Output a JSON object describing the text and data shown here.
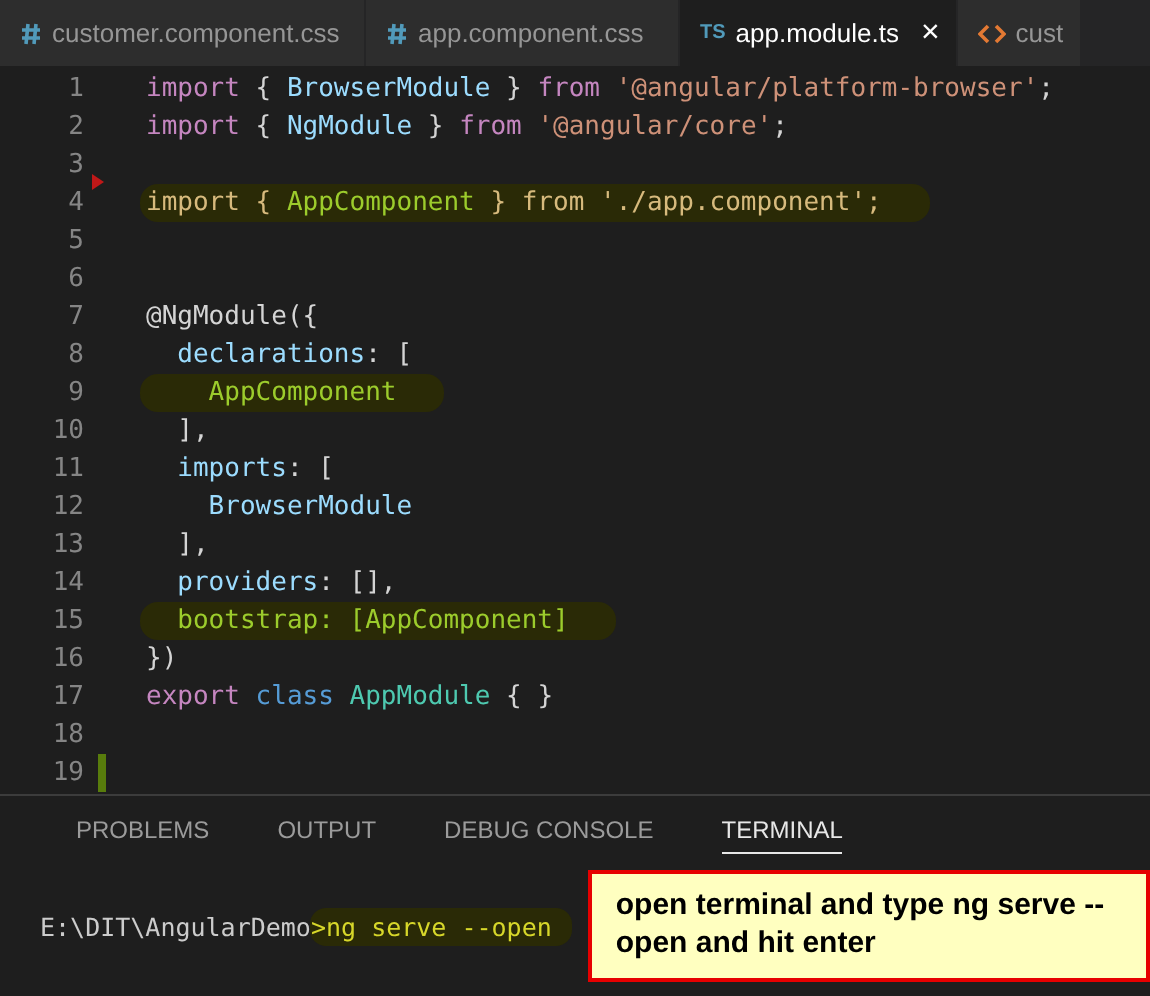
{
  "tabs": [
    {
      "label": "customer.component.css",
      "kind": "css",
      "selected": false
    },
    {
      "label": "app.component.css",
      "kind": "css",
      "selected": false
    },
    {
      "label": "app.module.ts",
      "kind": "ts",
      "icon_text": "TS",
      "close": "×",
      "selected": true
    },
    {
      "label": "cust",
      "kind": "html",
      "selected": false
    }
  ],
  "editor": {
    "lines": [
      {
        "number": "1",
        "highlighted": false,
        "added": false,
        "removed": false,
        "tokens": [
          {
            "text": "import",
            "kind": "keyword"
          },
          {
            "text": " { ",
            "kind": "punct"
          },
          {
            "text": "BrowserModule",
            "kind": "ident"
          },
          {
            "text": " } ",
            "kind": "punct"
          },
          {
            "text": "from",
            "kind": "keyword"
          },
          {
            "text": " '@angular/platform-browser'",
            "kind": "string"
          },
          {
            "text": ";",
            "kind": "punct"
          }
        ]
      },
      {
        "number": "2",
        "highlighted": false,
        "added": false,
        "removed": false,
        "tokens": [
          {
            "text": "import",
            "kind": "keyword"
          },
          {
            "text": " { ",
            "kind": "punct"
          },
          {
            "text": "NgModule",
            "kind": "ident"
          },
          {
            "text": " } ",
            "kind": "punct"
          },
          {
            "text": "from",
            "kind": "keyword"
          },
          {
            "text": " '@angular/core'",
            "kind": "string"
          },
          {
            "text": ";",
            "kind": "punct"
          }
        ]
      },
      {
        "number": "3",
        "highlighted": false,
        "added": false,
        "removed": false
      },
      {
        "number": "4",
        "highlighted": true,
        "added": false,
        "removed": true,
        "tokens": [
          {
            "text": "import { ",
            "kind": "hl"
          },
          {
            "text": "AppComponent",
            "kind": "hl_name"
          },
          {
            "text": " } from './app.component';",
            "kind": "hl"
          }
        ]
      },
      {
        "number": "5",
        "highlighted": false,
        "added": false,
        "removed": false
      },
      {
        "number": "6",
        "highlighted": false,
        "added": false,
        "removed": false
      },
      {
        "number": "7",
        "highlighted": false,
        "added": false,
        "removed": false,
        "tokens": [
          {
            "text": "@NgModule",
            "kind": "punct"
          },
          {
            "text": "({",
            "kind": "punct"
          }
        ]
      },
      {
        "number": "8",
        "highlighted": false,
        "added": false,
        "removed": false,
        "tokens": [
          {
            "text": "  declarations",
            "kind": "ident"
          },
          {
            "text": ": [",
            "kind": "punct"
          }
        ]
      },
      {
        "number": "9",
        "highlighted": true,
        "added": false,
        "removed": false,
        "tokens": [
          {
            "text": "    AppComponent",
            "kind": "hl_name"
          }
        ]
      },
      {
        "number": "10",
        "highlighted": false,
        "added": false,
        "removed": false,
        "tokens": [
          {
            "text": "  ],",
            "kind": "punct"
          }
        ]
      },
      {
        "number": "11",
        "highlighted": false,
        "added": false,
        "removed": false,
        "tokens": [
          {
            "text": "  imports",
            "kind": "ident"
          },
          {
            "text": ": [",
            "kind": "punct"
          }
        ]
      },
      {
        "number": "12",
        "highlighted": false,
        "added": false,
        "removed": false,
        "tokens": [
          {
            "text": "    BrowserModule",
            "kind": "ident"
          }
        ]
      },
      {
        "number": "13",
        "highlighted": false,
        "added": false,
        "removed": false,
        "tokens": [
          {
            "text": "  ],",
            "kind": "punct"
          }
        ]
      },
      {
        "number": "14",
        "highlighted": false,
        "added": false,
        "removed": false,
        "tokens": [
          {
            "text": "  providers",
            "kind": "ident"
          },
          {
            "text": ": [],",
            "kind": "punct"
          }
        ]
      },
      {
        "number": "15",
        "highlighted": true,
        "added": false,
        "removed": false,
        "tokens": [
          {
            "text": "  bootstrap: [",
            "kind": "hl_name"
          },
          {
            "text": "AppComponent",
            "kind": "hl_name"
          },
          {
            "text": "]",
            "kind": "hl_name"
          }
        ]
      },
      {
        "number": "16",
        "highlighted": false,
        "added": false,
        "removed": false,
        "tokens": [
          {
            "text": "})",
            "kind": "punct"
          }
        ]
      },
      {
        "number": "17",
        "highlighted": false,
        "added": false,
        "removed": false,
        "tokens": [
          {
            "text": "export",
            "kind": "keyword"
          },
          {
            "text": " class",
            "kind": "storage"
          },
          {
            "text": " AppModule",
            "kind": "class"
          },
          {
            "text": " { }",
            "kind": "punct"
          }
        ]
      },
      {
        "number": "18",
        "highlighted": false,
        "added": false,
        "removed": false
      },
      {
        "number": "19",
        "highlighted": false,
        "added": true,
        "removed": false
      }
    ]
  },
  "panel": {
    "tabs": [
      {
        "label": "PROBLEMS",
        "selected": false
      },
      {
        "label": "OUTPUT",
        "selected": false
      },
      {
        "label": "DEBUG CONSOLE",
        "selected": false
      },
      {
        "label": "TERMINAL",
        "selected": true
      }
    ],
    "terminal": {
      "prompt": "E:\\DIT\\AngularDemo",
      "command": ">ng serve --open"
    },
    "callout": "open terminal and type ng serve --open and hit enter"
  }
}
